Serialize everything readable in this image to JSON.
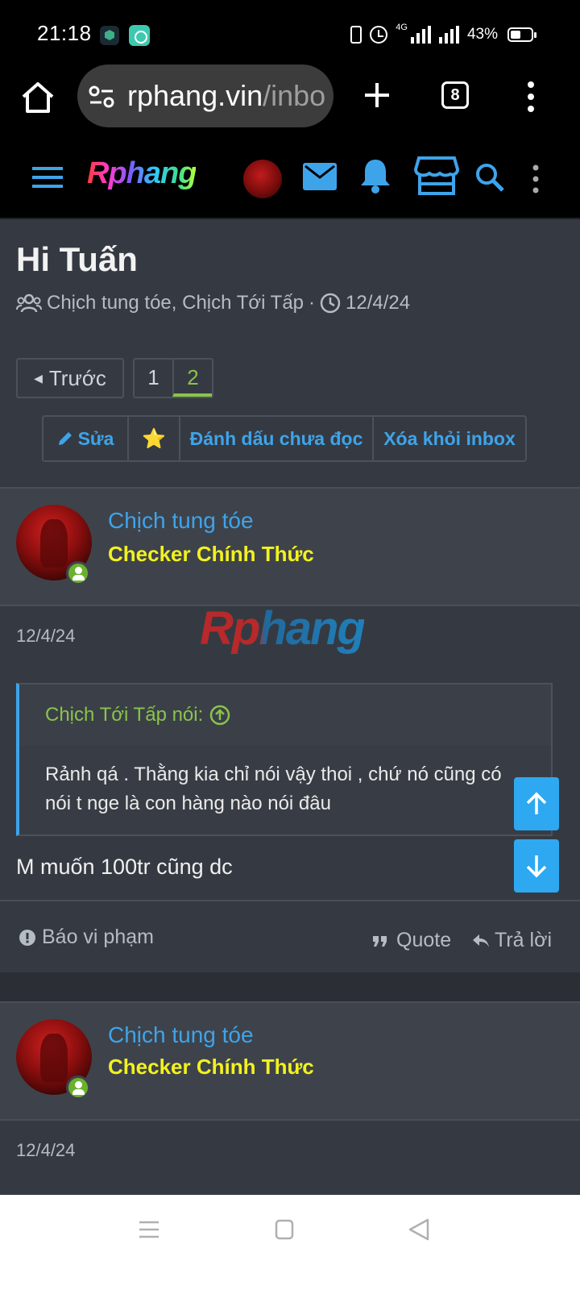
{
  "status_bar": {
    "time": "21:18",
    "network": "4G",
    "battery": "43%"
  },
  "browser": {
    "url_host": "rphang.vin",
    "url_rest": "/inbo",
    "tab_count": "8"
  },
  "site": {
    "logo": "Rphang"
  },
  "conversation": {
    "title": "Hi Tuấn",
    "participants": "Chịch tung tóe, Chịch Tới Tấp",
    "separator": "·",
    "date": "12/4/24"
  },
  "pager": {
    "prev_label": "Trước",
    "pages": [
      "1",
      "2"
    ],
    "current": "2"
  },
  "actions": {
    "edit": "Sửa",
    "star": "⭐",
    "mark_unread": "Đánh dấu chưa đọc",
    "remove": "Xóa khỏi inbox"
  },
  "messages": [
    {
      "username": "Chịch tung tóe",
      "user_title": "Checker Chính Thức",
      "date": "12/4/24",
      "watermark": "Rphang",
      "quote_author": "Chịch Tới Tấp nói:",
      "quote_text": "Rảnh qá . Thằng kia chỉ nói vậy thoi , chứ nó cũng có nói t nge là con hàng nào nói đâu",
      "text": "M muốn 100tr cũng dc",
      "report_label": "Báo vi phạm",
      "quote_label": "Quote",
      "reply_label": "Trả lời"
    },
    {
      "username": "Chịch tung tóe",
      "user_title": "Checker Chính Thức",
      "date": "12/4/24"
    }
  ],
  "colors": {
    "accent": "#3ea4ea",
    "user_title": "#f2f21e",
    "online": "#6ab22d",
    "quote_author": "#8bc34a",
    "background": "#353a42"
  }
}
